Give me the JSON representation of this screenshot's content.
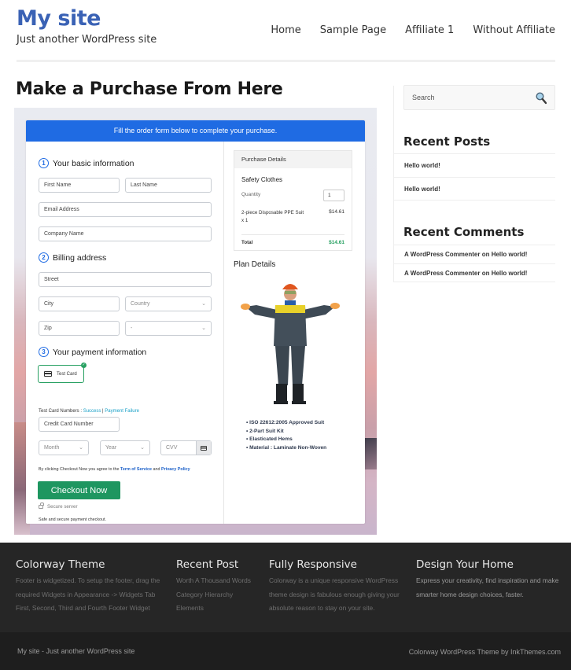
{
  "site": {
    "title": "My site",
    "tagline": "Just another WordPress site"
  },
  "nav": {
    "items": [
      {
        "label": "Home"
      },
      {
        "label": "Sample Page"
      },
      {
        "label": "Affiliate 1"
      },
      {
        "label": "Without Affiliate"
      }
    ]
  },
  "page": {
    "title": "Make a Purchase From Here"
  },
  "checkout": {
    "banner": "Fill the order form below to complete your purchase.",
    "steps": [
      {
        "num": "1",
        "label": "Your basic information"
      },
      {
        "num": "2",
        "label": "Billing address"
      },
      {
        "num": "3",
        "label": "Your payment information"
      }
    ],
    "fields": {
      "first_name": "First Name",
      "last_name": "Last Name",
      "email": "Email Address",
      "company": "Company Name",
      "street": "Street",
      "city": "City",
      "country": "Country",
      "zip": "Zip",
      "state": "-",
      "card_number": "Credit Card Number",
      "month": "Month",
      "year": "Year",
      "cvv": "CVV"
    },
    "payment_method": "Test Card",
    "test_card_label": "Test Card Numbers : ",
    "test_success": "Success",
    "test_separator": " | ",
    "test_failure": "Payment Failure",
    "agree_prefix": "By clicking Checkout Now you agree to the ",
    "terms_link": "Term of Service",
    "agree_and": " and ",
    "privacy_link": "Privacy Policy",
    "checkout_button": "Checkout Now",
    "secure_server": "Secure server",
    "safe_text": "Safe and secure payment checkout.",
    "purchase": {
      "heading": "Purchase Details",
      "product": "Safety Clothes",
      "quantity_label": "Quantity",
      "quantity": "1",
      "item": "2-piece Disposable PPE Suit x 1",
      "item_price": "$14.61",
      "total_label": "Total",
      "total": "$14.61"
    },
    "plan": {
      "title": "Plan Details",
      "features": [
        "ISO 22612:2005 Approved Suit",
        "2-Part Suit Kit",
        "Elasticated Hems",
        "Material : Laminate Non-Woven"
      ]
    }
  },
  "sidebar": {
    "search_placeholder": "Search",
    "recent_posts_title": "Recent Posts",
    "recent_posts": [
      "Hello world!",
      "Hello world!"
    ],
    "recent_comments_title": "Recent Comments",
    "recent_comments": [
      {
        "author": "A WordPress Commenter",
        "on": " on ",
        "post": "Hello world!"
      },
      {
        "author": "A WordPress Commenter",
        "on": " on ",
        "post": "Hello world!"
      }
    ]
  },
  "footer": {
    "col1": {
      "title": "Colorway Theme",
      "text": "Footer is widgetized. To setup the footer, drag the required Widgets in Appearance -> Widgets Tab First, Second, Third and Fourth Footer Widget"
    },
    "col2": {
      "title": "Recent Post",
      "items": [
        "Worth A Thousand Words",
        "Category Hierarchy",
        "Elements"
      ]
    },
    "col3": {
      "title": "Fully Responsive",
      "text": "Colorway is a unique responsive WordPress theme design is fabulous enough giving your absolute reason to stay on your site."
    },
    "col4": {
      "title": "Design Your Home",
      "text": "Express your creativity, find inspiration and make smarter home design choices, faster."
    },
    "bottom_left": "My site - Just another WordPress site",
    "bottom_right": "Colorway WordPress Theme by InkThemes.com"
  },
  "colors": {
    "brand_blue": "#3a62b5",
    "banner_blue": "#1f6be3",
    "checkout_green": "#1e9660",
    "total_green": "#27a061",
    "footer_bg": "#262626"
  }
}
